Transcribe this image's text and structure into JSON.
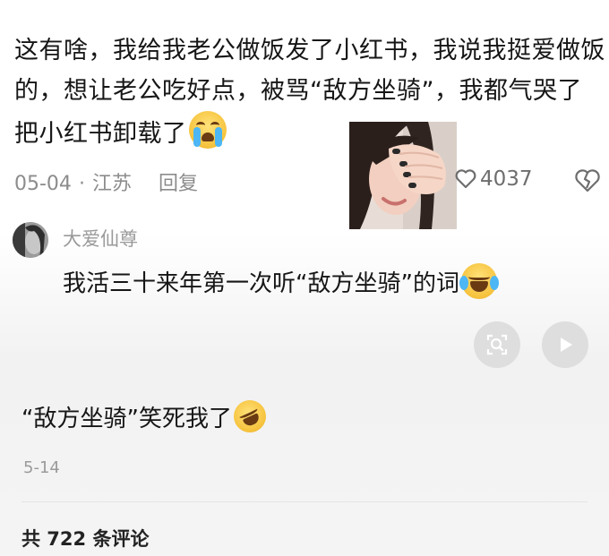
{
  "comment": {
    "text": "这有啥，我给我老公做饭发了小红书，我说我挺爱做饭的，想让老公吃好点，被骂“敌方坐骑”，我都气哭了把小红书卸载了",
    "emoji": "loudly-crying-face",
    "date": "05-04",
    "location": "江苏",
    "reply_label": "回复",
    "like_count": "4037",
    "dot": "·"
  },
  "reply": {
    "author": "大爱仙尊",
    "text": "我活三十来年第一次听“敌方坐骑”的词",
    "emoji": "face-with-tears-of-joy"
  },
  "media_buttons": {
    "scan_icon": "image-search-icon",
    "play_icon": "play-icon"
  },
  "second_comment": {
    "text": "“敌方坐骑”笑死我了",
    "emoji": "rolling-on-the-floor-laughing",
    "date": "5-14"
  },
  "footer": {
    "comment_count": "共 722 条评论"
  },
  "colors": {
    "text": "#161616",
    "meta": "#8c8c8c",
    "button_bg": "#dedede"
  }
}
